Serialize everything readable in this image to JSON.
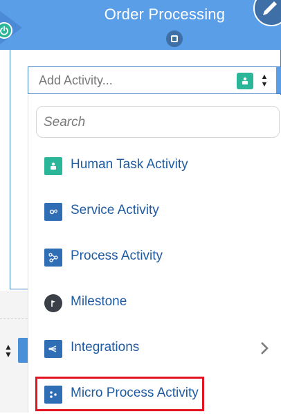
{
  "header": {
    "title": "Order Processing",
    "color": "#5b9ee8",
    "accent": "#3e6fa6"
  },
  "activity_combo": {
    "placeholder": "Add Activity...",
    "icon": "human-task-icon"
  },
  "dropdown": {
    "search_placeholder": "Search",
    "items": [
      {
        "label": "Human Task Activity",
        "icon": "human-task-icon",
        "icon_color": "#2bb69a"
      },
      {
        "label": "Service Activity",
        "icon": "service-gears-icon",
        "icon_color": "#2f6db5"
      },
      {
        "label": "Process Activity",
        "icon": "process-icon",
        "icon_color": "#2f6db5"
      },
      {
        "label": "Milestone",
        "icon": "flag-icon",
        "icon_color": "#3b3f47"
      },
      {
        "label": "Integrations",
        "icon": "integration-icon",
        "icon_color": "#2f6db5",
        "has_submenu": true
      },
      {
        "label": "Micro Process Activity",
        "icon": "micro-process-icon",
        "icon_color": "#2f6db5",
        "highlighted": true
      }
    ]
  },
  "highlight_color": "#e3141f"
}
